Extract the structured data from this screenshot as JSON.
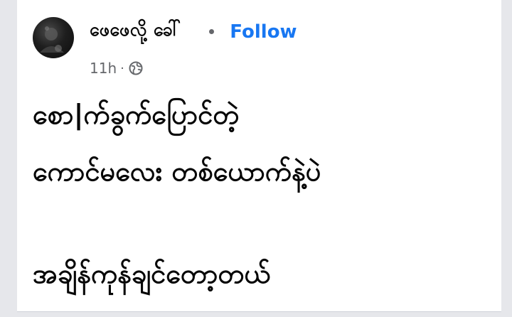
{
  "post": {
    "author_name": "ဖေဖေလို့ ခေါ်",
    "follow_label": "Follow",
    "timestamp": "11h",
    "separator": "·",
    "privacy_icon": "globe-icon",
    "lines": [
      "စော|က်ခွက်ပြောင်တဲ့",
      "ကောင်မလေး တစ်ယောက်နဲ့ပဲ",
      "",
      "အချိန်ကုန်ချင်တော့တယ်"
    ]
  },
  "colors": {
    "follow": "#1877f2",
    "text": "#050505",
    "meta": "#65676b",
    "card_background": "#ffffff",
    "page_background": "#e6e7eb"
  }
}
